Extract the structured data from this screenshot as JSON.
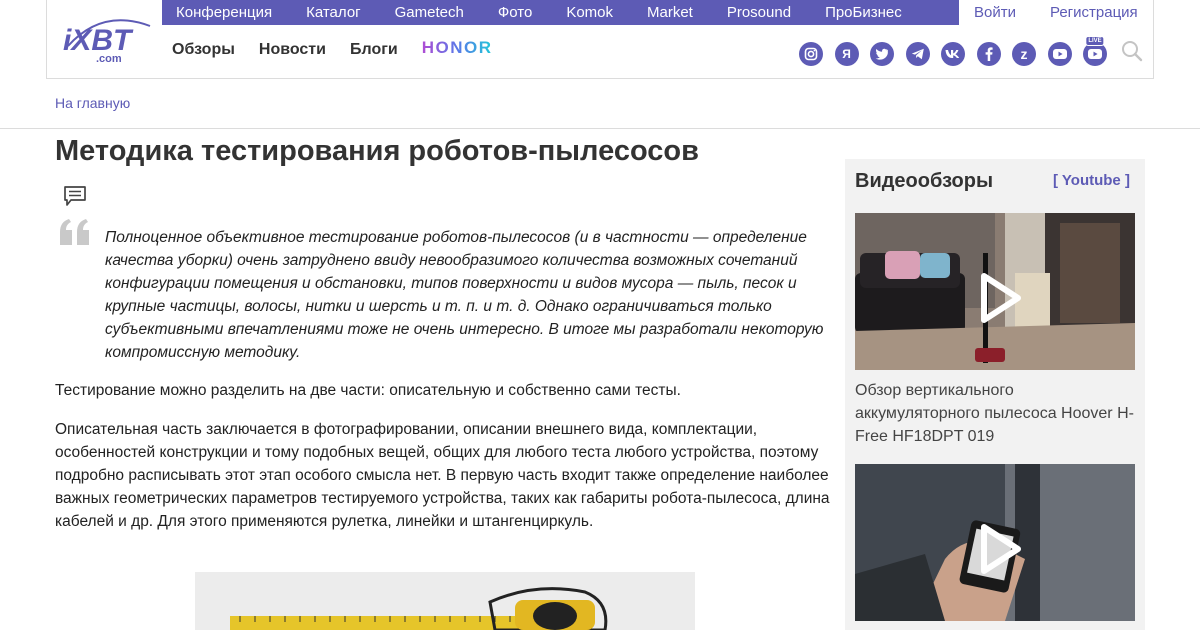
{
  "topnav": [
    "Конференция",
    "Каталог",
    "Gametech",
    "Фото",
    "Komok",
    "Market",
    "Prosound",
    "ПроБизнес"
  ],
  "auth": {
    "login": "Войти",
    "register": "Регистрация"
  },
  "logo": {
    "main": "iXBT",
    "sub": ".com"
  },
  "mainnav": [
    "Обзоры",
    "Новости",
    "Блоги"
  ],
  "brand_banner": "HONOR",
  "socials": [
    "instagram-icon",
    "yandex-icon",
    "twitter-icon",
    "telegram-icon",
    "vk-icon",
    "facebook-icon",
    "zen-icon",
    "youtube-icon",
    "youtube-live-icon"
  ],
  "social_labels": {
    "yandex": "Я",
    "zen": "z",
    "live": "LIVE"
  },
  "breadcrumb": "На главную",
  "title": "Методика тестирования роботов-пылесосов",
  "lead": "Полноценное объективное тестирование роботов-пылесосов (и в частности — определение качества уборки) очень затруднено ввиду невообразимого количества возможных сочетаний конфигурации помещения и обстановки, типов поверхности и видов мусора — пыль, песок и крупные частицы, волосы, нитки и шерсть и т. п. и т. д. Однако ограничиваться только субъективными впечатлениями тоже не очень интересно. В итоге мы разработали некоторую компромиссную методику.",
  "paragraphs": [
    "Тестирование можно разделить на две части: описательную и собственно сами тесты.",
    "Описательная часть заключается в фотографировании, описании внешнего вида, комплектации, особенностей конструкции и тому подобных вещей, общих для любого теста любого устройства, поэтому подробно расписывать этот этап особого смысла нет. В первую часть входит также определение наиболее важных геометрических параметров тестируемого устройства, таких как габариты робота-пылесоса, длина кабелей и др. Для этого применяются рулетка, линейки и штангенциркуль."
  ],
  "sidebar": {
    "title": "Видеообзоры",
    "youtube_link": "[ Youtube ]",
    "videos": [
      {
        "title": "Обзор вертикального аккумуляторного пылесоса Hoover H-Free HF18DPT 019"
      },
      {
        "title": ""
      }
    ]
  },
  "colors": {
    "accent": "#5d5bb5",
    "text": "#222222",
    "sidebar_bg": "#f2f2f2"
  }
}
